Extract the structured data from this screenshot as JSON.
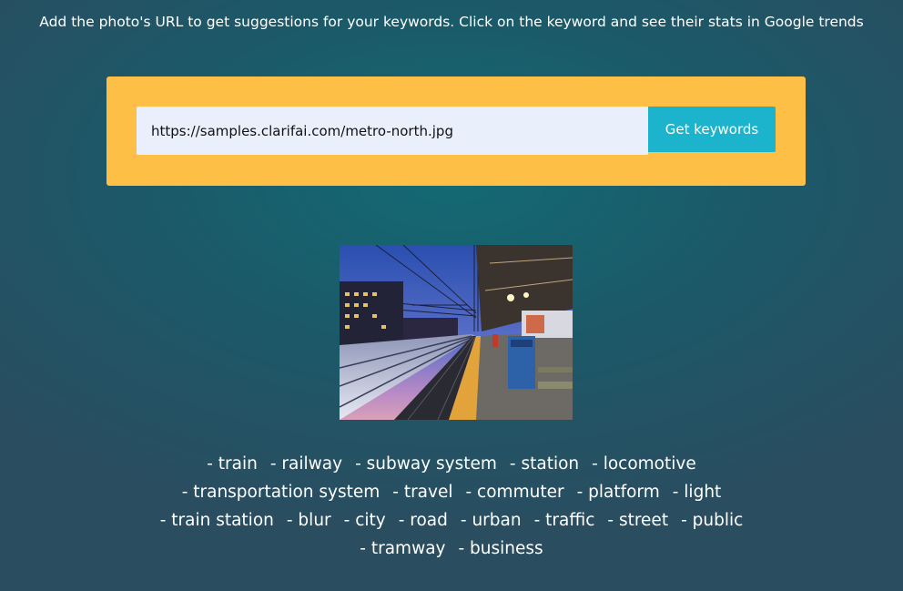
{
  "instructions": "Add the photo's URL to get suggestions for your keywords. Click on the keyword and see their stats in Google trends",
  "form": {
    "url_value": "https://samples.clarifai.com/metro-north.jpg",
    "button_label": "Get keywords"
  },
  "keywords": [
    "- train",
    "- railway",
    "- subway system",
    "- station",
    "- locomotive",
    "- transportation system",
    "- travel",
    "- commuter",
    "- platform",
    "- light",
    "- train station",
    "- blur",
    "- city",
    "- road",
    "- urban",
    "- traffic",
    "- street",
    "- public",
    "- tramway",
    "- business"
  ],
  "colors": {
    "panel": "#fdbf45",
    "button": "#1bb4cc",
    "input_bg": "#e9f0fb"
  }
}
